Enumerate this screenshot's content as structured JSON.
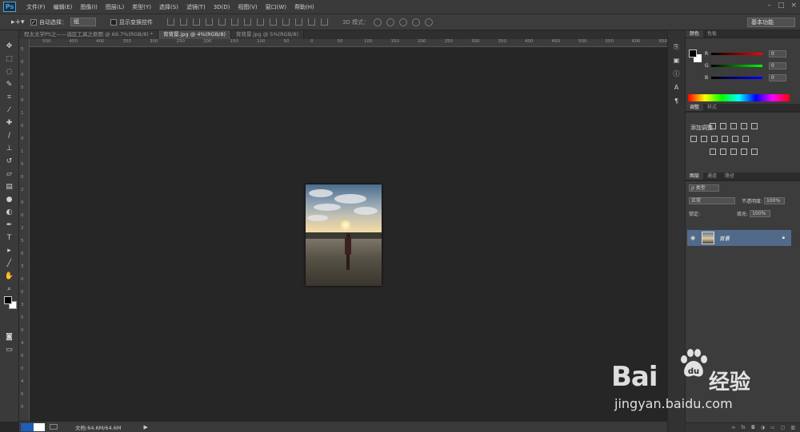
{
  "app": {
    "logo": "Ps"
  },
  "menu": {
    "items": [
      "文件(F)",
      "编辑(E)",
      "图像(I)",
      "图层(L)",
      "类型(Y)",
      "选择(S)",
      "滤镜(T)",
      "3D(D)",
      "视图(V)",
      "窗口(W)",
      "帮助(H)"
    ]
  },
  "options": {
    "auto_select_label": "自动选择：",
    "auto_select_value": "组",
    "show_transform_label": "显示变换控件",
    "mode3d_label": "3D 模式：",
    "workspace": "基本功能"
  },
  "tabs": [
    {
      "label": "程太太学PS之——选区工具之抠图 @ 66.7%(RGB/8) *",
      "active": false
    },
    {
      "label": "背背景.jpg @ 4%(RGB/8)",
      "active": true
    },
    {
      "label": "背背景.jpg @ 5%(RGB/8)",
      "active": false
    }
  ],
  "ruler_top": [
    "500",
    "450",
    "400",
    "350",
    "300",
    "250",
    "200",
    "150",
    "100",
    "50",
    "0",
    "50",
    "100",
    "150",
    "200",
    "250",
    "300",
    "350",
    "400",
    "450",
    "500",
    "550",
    "600",
    "650"
  ],
  "ruler_left": [
    "5",
    "0",
    "0",
    "5",
    "0",
    "1",
    "0",
    "0",
    "1",
    "5",
    "0",
    "2",
    "0",
    "0",
    "2",
    "5",
    "0",
    "3",
    "0",
    "0",
    "3",
    "5",
    "0",
    "4",
    "0",
    "0",
    "4",
    "5",
    "0"
  ],
  "status": {
    "doc_info": "文档:64.6M/64.6M"
  },
  "panels": {
    "color_tabs": [
      "颜色",
      "色板"
    ],
    "r": {
      "label": "R",
      "value": "0"
    },
    "g": {
      "label": "G",
      "value": "0"
    },
    "b": {
      "label": "B",
      "value": "0"
    },
    "adj_tabs": [
      "调整",
      "样式"
    ],
    "adj_title": "添加调整",
    "layer_tabs": [
      "图层",
      "通道",
      "路径"
    ],
    "kind_label": "ρ 类型",
    "blend_mode": "正常",
    "opacity_label": "不透明度:",
    "opacity_value": "100%",
    "lock_label": "锁定:",
    "fill_label": "填充:",
    "fill_value": "100%",
    "layer_name": "背景"
  },
  "watermark": {
    "bai": "Bai",
    "jy": "经验",
    "url": "jingyan.baidu.com"
  },
  "colors": {
    "accent": "#526a8a",
    "canvas": "#262626",
    "panel": "#3c3c3c"
  }
}
